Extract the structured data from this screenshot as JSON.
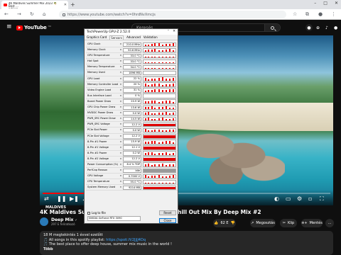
{
  "browser": {
    "tab_title": "4K Maldives Summer Mix 2023 🌴 Best ...\nadásra",
    "url": "https://www.youtube.com/watch?v=0hrdNvXmcjs",
    "win_controls": [
      "–",
      "□",
      "✕"
    ]
  },
  "youtube": {
    "logo_text": "YouTube",
    "logo_cc": "HU",
    "search_placeholder": "Keresés",
    "video_title": "4K Maldives Summer M",
    "video_title_right": "hill Out Mix By Deep Mix #2",
    "channel_name": "Deep Mix",
    "channel_verified": "✔",
    "subscribers": "297 E feliratkozó",
    "like_label": "62 E",
    "share_label": "Megosztás",
    "clip_label": "Klip",
    "save_label": "Mentés",
    "more_label": "…",
    "progress": 0.28,
    "desc_line1": "18 M megtekintés  1 évvel ezelőtt",
    "desc_line2_prefix": "🎵 All songs in this spotify playlist: ",
    "desc_link": "https://spoti.fi/2JJjJ4Dq",
    "desc_line3": "🎵 The best place to offer deep house, summer mix music in the world !",
    "desc_more": "Több",
    "overlay_tag": "MALDIVES"
  },
  "gpuz": {
    "title": "TechPowerUp GPU-Z 2.52.0",
    "tabs": [
      "Graphics Card",
      "Sensors",
      "Advanced",
      "Validation"
    ],
    "active_tab": "Sensors",
    "sensors": [
      {
        "label": "GPU Clock",
        "value": "210.0 MHz",
        "graph": "spikes"
      },
      {
        "label": "Memory Clock",
        "value": "50.6 MHz",
        "graph": "spikes"
      },
      {
        "label": "GPU Temperature",
        "value": "33.0 °C",
        "graph": "low"
      },
      {
        "label": "Hot Spot",
        "value": "33.0 °C",
        "graph": "low"
      },
      {
        "label": "Memory Temperature",
        "value": "34.0 °C",
        "graph": "low"
      },
      {
        "label": "Memory Used",
        "value": "1896 MB",
        "graph": "low"
      },
      {
        "label": "GPU Load",
        "value": "22 %",
        "graph": "spikes"
      },
      {
        "label": "Memory Controller Load",
        "value": "20 %",
        "graph": "spikes"
      },
      {
        "label": "Video Engine Load",
        "value": "31 %",
        "graph": "spikes"
      },
      {
        "label": "Bus Interface Load",
        "value": "0 %",
        "graph": "none"
      },
      {
        "label": "Board Power Draw",
        "value": "20.9 W",
        "graph": "spikes"
      },
      {
        "label": "GPU Chip Power Draw",
        "value": "13.6 W",
        "graph": "spikes"
      },
      {
        "label": "MVDDC Power Draw",
        "value": "0.0 W",
        "graph": "spikes"
      },
      {
        "label": "PWR_SRC Power Draw",
        "value": "14.5 W",
        "graph": "spikes"
      },
      {
        "label": "PWR_SRC Voltage",
        "value": "12.2 V",
        "graph": "full"
      },
      {
        "label": "PCIe Slot Power",
        "value": "0.0 W",
        "graph": "spikes"
      },
      {
        "label": "PCIe Slot Voltage",
        "value": "12.2 V",
        "graph": "full"
      },
      {
        "label": "8-Pin #1 Power",
        "value": "15.9 W",
        "graph": "spikes"
      },
      {
        "label": "8-Pin #1 Voltage",
        "value": "12.1 V",
        "graph": "full"
      },
      {
        "label": "8-Pin #2 Power",
        "value": "0.2 W",
        "graph": "spikes"
      },
      {
        "label": "8-Pin #2 Voltage",
        "value": "12.2 V",
        "graph": "full"
      },
      {
        "label": "Power Consumption (%)",
        "value": "8.4 % TDP",
        "graph": "spikes"
      },
      {
        "label": "PerfCap Reason",
        "value": "Idle",
        "graph": "gray"
      },
      {
        "label": "GPU Voltage",
        "value": "0.7000 V",
        "graph": "spikes"
      },
      {
        "label": "CPU Temperature",
        "value": "55.0 °C",
        "graph": "low"
      },
      {
        "label": "System Memory Used",
        "value": "9214 MB",
        "graph": "full"
      }
    ],
    "log_label": "Log to file",
    "reset_label": "Reset",
    "device": "NVIDIA GeForce RTX 3090",
    "close_label": "Close"
  }
}
